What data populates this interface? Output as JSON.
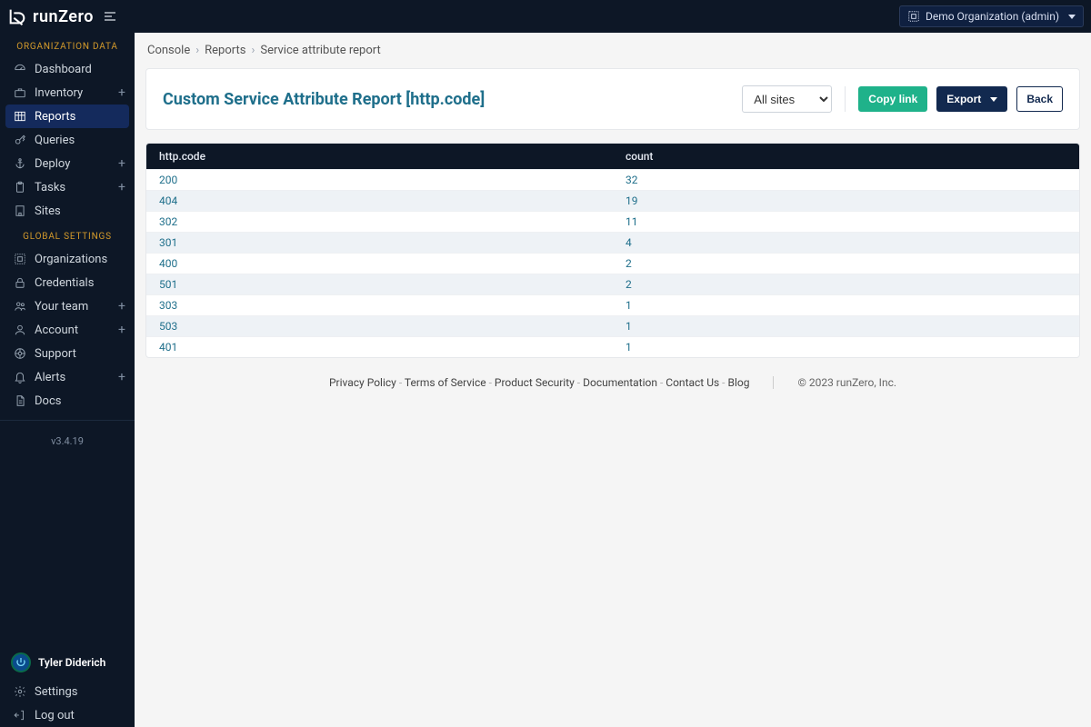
{
  "topbar": {
    "brand": "runZero",
    "org_label": "Demo Organization (admin)"
  },
  "sidebar": {
    "section1_title": "ORGANIZATION DATA",
    "section2_title": "GLOBAL SETTINGS",
    "items1": [
      {
        "label": "Dashboard",
        "icon": "gauge-icon"
      },
      {
        "label": "Inventory",
        "icon": "briefcase-icon",
        "plus": true
      },
      {
        "label": "Reports",
        "icon": "table-icon",
        "active": true
      },
      {
        "label": "Queries",
        "icon": "key-icon"
      },
      {
        "label": "Deploy",
        "icon": "anchor-icon",
        "plus": true
      },
      {
        "label": "Tasks",
        "icon": "clipboard-icon",
        "plus": true
      },
      {
        "label": "Sites",
        "icon": "building-icon"
      }
    ],
    "items2": [
      {
        "label": "Organizations",
        "icon": "org-icon"
      },
      {
        "label": "Credentials",
        "icon": "lock-icon"
      },
      {
        "label": "Your team",
        "icon": "users-icon",
        "plus": true
      },
      {
        "label": "Account",
        "icon": "user-icon",
        "plus": true
      },
      {
        "label": "Support",
        "icon": "support-icon"
      },
      {
        "label": "Alerts",
        "icon": "bell-icon",
        "plus": true
      },
      {
        "label": "Docs",
        "icon": "file-icon"
      }
    ],
    "version": "v3.4.19",
    "user_name": "Tyler Diderich",
    "settings_label": "Settings",
    "logout_label": "Log out"
  },
  "breadcrumbs": {
    "items": [
      "Console",
      "Reports",
      "Service attribute report"
    ]
  },
  "panel": {
    "title": "Custom Service Attribute Report [http.code]",
    "site_select": "All sites",
    "copy_link": "Copy link",
    "export": "Export",
    "back": "Back"
  },
  "table": {
    "headers": {
      "col1": "http.code",
      "col2": "count"
    },
    "rows": [
      {
        "code": "200",
        "count": "32"
      },
      {
        "code": "404",
        "count": "19"
      },
      {
        "code": "302",
        "count": "11"
      },
      {
        "code": "301",
        "count": "4"
      },
      {
        "code": "400",
        "count": "2"
      },
      {
        "code": "501",
        "count": "2"
      },
      {
        "code": "303",
        "count": "1"
      },
      {
        "code": "503",
        "count": "1"
      },
      {
        "code": "401",
        "count": "1"
      }
    ]
  },
  "footer": {
    "links": [
      "Privacy Policy",
      "Terms of Service",
      "Product Security",
      "Documentation",
      "Contact Us",
      "Blog"
    ],
    "copyright": "© 2023 runZero, Inc."
  }
}
